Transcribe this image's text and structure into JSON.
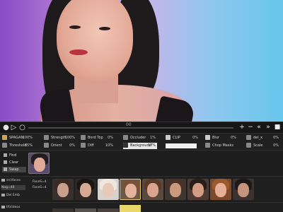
{
  "timeline": {
    "marker": "00",
    "buttons": [
      "+",
      "−",
      "«",
      "»",
      "■"
    ]
  },
  "controls": {
    "swap": {
      "label": "SPAGAN",
      "value": "100%"
    },
    "strength": {
      "label": "Strength",
      "value": "100%"
    },
    "bord_top": {
      "label": "Bord Top",
      "value": "0%"
    },
    "occluder": {
      "label": "Occluder",
      "value": "1%"
    },
    "clip": {
      "label": "CLIP",
      "value": "0%"
    },
    "blur": {
      "label": "Blur",
      "value": "0%"
    },
    "del": {
      "label": "del_x",
      "value": "0%"
    },
    "threshold": {
      "label": "Threshold",
      "value": "65%"
    },
    "orient": {
      "label": "Orient",
      "value": "0%"
    },
    "diff": {
      "label": "Diff",
      "value": "10%"
    },
    "background": {
      "label": "Background",
      "value": "17%"
    },
    "chop_masks": {
      "label": "Chop Masks",
      "value": ""
    },
    "scale": {
      "label": "Scale",
      "value": "0%"
    }
  },
  "faceset_panel": {
    "buttons": [
      "Find",
      "Clear",
      "Swap"
    ]
  },
  "faces_panel": {
    "path": "src\\faces",
    "labels": [
      "FaceS=4",
      "FaceS=4",
      "Neg=40"
    ],
    "del_btn": "Del Emb"
  },
  "videos_panel": {
    "path": "tl\\Videos"
  }
}
